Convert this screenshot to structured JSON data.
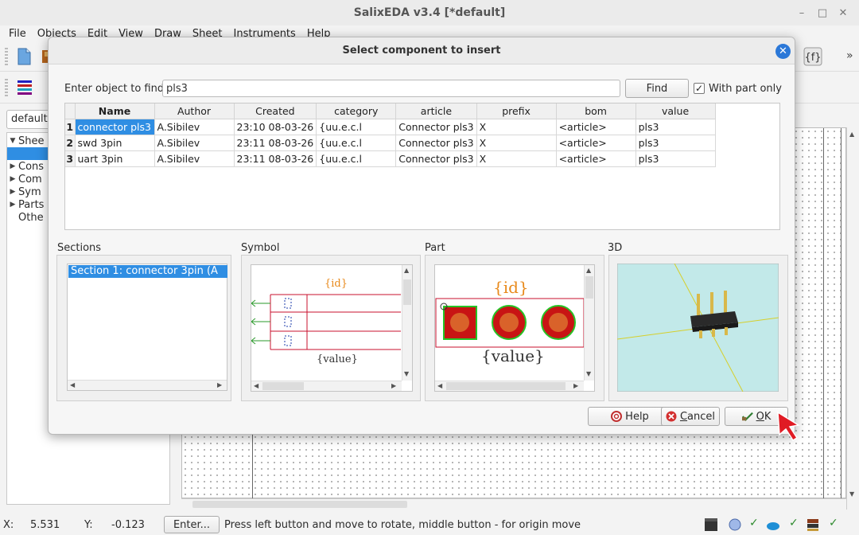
{
  "window": {
    "title": "SalixEDA v3.4 [*default]",
    "minimize": "–",
    "maximize": "□",
    "close": "✕"
  },
  "menu": [
    "File",
    "Objects",
    "Edit",
    "View",
    "Draw",
    "Sheet",
    "Instruments",
    "Help"
  ],
  "toolbar": {
    "overflow": "»"
  },
  "left_panel": {
    "combo_value": "default",
    "tree": [
      "Shee",
      "Cons",
      "Com",
      "Sym",
      "Parts",
      "Othe"
    ]
  },
  "dialog": {
    "title": "Select component to insert",
    "close_glyph": "✕",
    "find_label": "Enter object to find:",
    "find_value": "pls3",
    "find_button": "Find",
    "with_part_only_label": "With part only",
    "with_part_only_checked": true,
    "check_glyph": "✓",
    "table": {
      "columns": [
        "Name",
        "Author",
        "Created",
        "category",
        "article",
        "prefix",
        "bom",
        "value"
      ],
      "rows": [
        [
          "1",
          "connector pls3",
          "A.Sibilev",
          "23:10 08-03-26",
          "{uu.e.c.l",
          "Connector pls3",
          "X",
          "<article>",
          "pls3"
        ],
        [
          "2",
          "swd 3pin",
          "A.Sibilev",
          "23:11 08-03-26",
          "{uu.e.c.l",
          "Connector pls3",
          "X",
          "<article>",
          "pls3"
        ],
        [
          "3",
          "uart 3pin",
          "A.Sibilev",
          "23:11 08-03-26",
          "{uu.e.c.l",
          "Connector pls3",
          "X",
          "<article>",
          "pls3"
        ]
      ]
    },
    "sections_label": "Sections",
    "section_item": "Section 1: connector 3pin     (A",
    "symbol_label": "Symbol",
    "symbol_id": "{id}",
    "symbol_value": "{value}",
    "part_label": "Part",
    "part_id": "{id}",
    "part_value": "{value}",
    "view3d_label": "3D",
    "help_button": "Help",
    "cancel_first": "C",
    "cancel_rest": "ancel",
    "ok_first": "O",
    "ok_rest": "K"
  },
  "status": {
    "x_label": "X:",
    "x_value": "5.531",
    "y_label": "Y:",
    "y_value": "-0.123",
    "enter_button": "Enter...",
    "hint": "Press left button and move to rotate, middle button - for origin move",
    "check": "✓"
  },
  "colors": {
    "selection": "#2f8ee3",
    "close_button": "#2b78d8",
    "symbol_red": "#c8102e",
    "id_orange": "#e8891a",
    "pad_red": "#c81414",
    "pad_ring": "#26c426",
    "pad_core": "#d9622a",
    "view3d_bg": "#c2e9e9"
  }
}
